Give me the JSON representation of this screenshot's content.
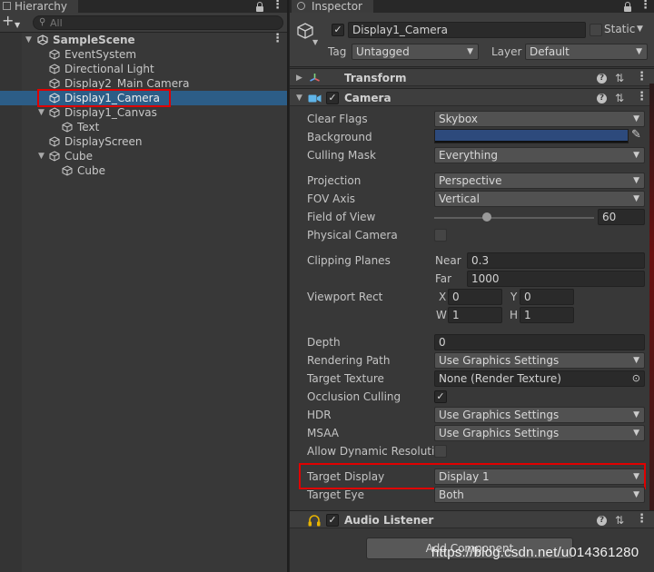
{
  "hierarchy": {
    "tab_label": "Hierarchy",
    "search_placeholder": "All",
    "items": [
      {
        "label": "SampleScene"
      },
      {
        "label": "EventSystem"
      },
      {
        "label": "Directional Light"
      },
      {
        "label": "Display2_Main Camera"
      },
      {
        "label": "Display1_Camera"
      },
      {
        "label": "Display1_Canvas"
      },
      {
        "label": "Text"
      },
      {
        "label": "DisplayScreen"
      },
      {
        "label": "Cube"
      },
      {
        "label": "Cube"
      }
    ]
  },
  "inspector": {
    "tab_label": "Inspector",
    "object_name": "Display1_Camera",
    "static_label": "Static",
    "tag_label": "Tag",
    "tag_value": "Untagged",
    "layer_label": "Layer",
    "layer_value": "Default",
    "transform_title": "Transform",
    "camera_title": "Camera",
    "audio_title": "Audio Listener",
    "add_component": "Add Component",
    "camera": {
      "clear_flags_label": "Clear Flags",
      "clear_flags_value": "Skybox",
      "background_label": "Background",
      "background_color": "#2d4a7c",
      "culling_mask_label": "Culling Mask",
      "culling_mask_value": "Everything",
      "projection_label": "Projection",
      "projection_value": "Perspective",
      "fov_axis_label": "FOV Axis",
      "fov_axis_value": "Vertical",
      "fov_label": "Field of View",
      "fov_value": "60",
      "fov_slider_fraction": 0.33,
      "physical_camera_label": "Physical Camera",
      "clipping_label": "Clipping Planes",
      "near_label": "Near",
      "near_value": "0.3",
      "far_label": "Far",
      "far_value": "1000",
      "viewport_label": "Viewport Rect",
      "x_label": "X",
      "x_value": "0",
      "y_label": "Y",
      "y_value": "0",
      "w_label": "W",
      "w_value": "1",
      "h_label": "H",
      "h_value": "1",
      "depth_label": "Depth",
      "depth_value": "0",
      "rendering_path_label": "Rendering Path",
      "rendering_path_value": "Use Graphics Settings",
      "target_texture_label": "Target Texture",
      "target_texture_value": "None (Render Texture)",
      "occlusion_label": "Occlusion Culling",
      "hdr_label": "HDR",
      "hdr_value": "Use Graphics Settings",
      "msaa_label": "MSAA",
      "msaa_value": "Use Graphics Settings",
      "dyn_res_label": "Allow Dynamic Resolutio",
      "target_display_label": "Target Display",
      "target_display_value": "Display 1",
      "target_eye_label": "Target Eye",
      "target_eye_value": "Both"
    }
  },
  "watermark": "https://blog.csdn.net/u014361280",
  "colors": {
    "selection": "#2c5d87",
    "highlight_box": "#e00000",
    "camera_icon": "#5fb4e8",
    "audio_icon": "#e8b400"
  }
}
